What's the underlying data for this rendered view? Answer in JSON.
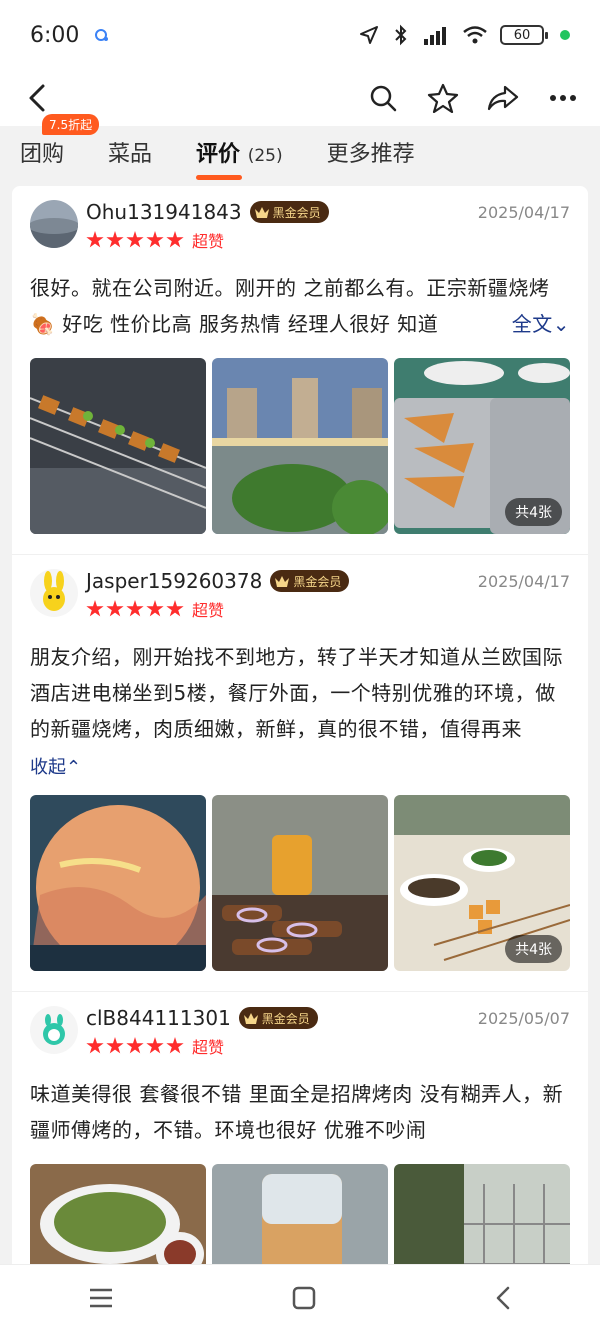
{
  "status_bar": {
    "time": "6:00",
    "battery": "60"
  },
  "nav": {
    "back_icon": "back-arrow-icon",
    "icons": [
      "search-icon",
      "star-icon",
      "share-icon",
      "more-icon"
    ]
  },
  "tabs": [
    {
      "label": "团购",
      "badge": "7.5折起"
    },
    {
      "label": "菜品"
    },
    {
      "label": "评价",
      "count": "(25)"
    },
    {
      "label": "更多推荐"
    }
  ],
  "reviews": [
    {
      "user": "Ohu131941843",
      "vip": "黑金会员",
      "date": "2025/04/17",
      "rating_text": "超赞",
      "text": "很好。就在公司附近。刚开的 之前都么有。正宗新疆烧烤🍖 好吃 性价比高 服务热情 经理人很好 知道",
      "more": "全文⌄",
      "photo_count": "共4张"
    },
    {
      "user": "Jasper159260378",
      "vip": "黑金会员",
      "date": "2025/04/17",
      "rating_text": "超赞",
      "text": "朋友介绍，刚开始找不到地方，转了半天才知道从兰欧国际酒店进电梯坐到5楼，餐厅外面，一个特别优雅的环境，做的新疆烧烤，肉质细嫩，新鲜，真的很不错，值得再来",
      "collapse": "收起⌃",
      "photo_count": "共4张"
    },
    {
      "user": "clB844111301",
      "vip": "黑金会员",
      "date": "2025/05/07",
      "rating_text": "超赞",
      "text": "味道美得很 套餐很不错 里面全是招牌烤肉 没有糊弄人，新疆师傅烤的，不错。环境也很好 优雅不吵闹"
    }
  ],
  "colors": {
    "accent": "#ff5a1f",
    "star": "#ff2d2d",
    "link": "#1e3a8a",
    "vip_bg": "#4a2a12",
    "vip_text": "#f6d68a"
  }
}
